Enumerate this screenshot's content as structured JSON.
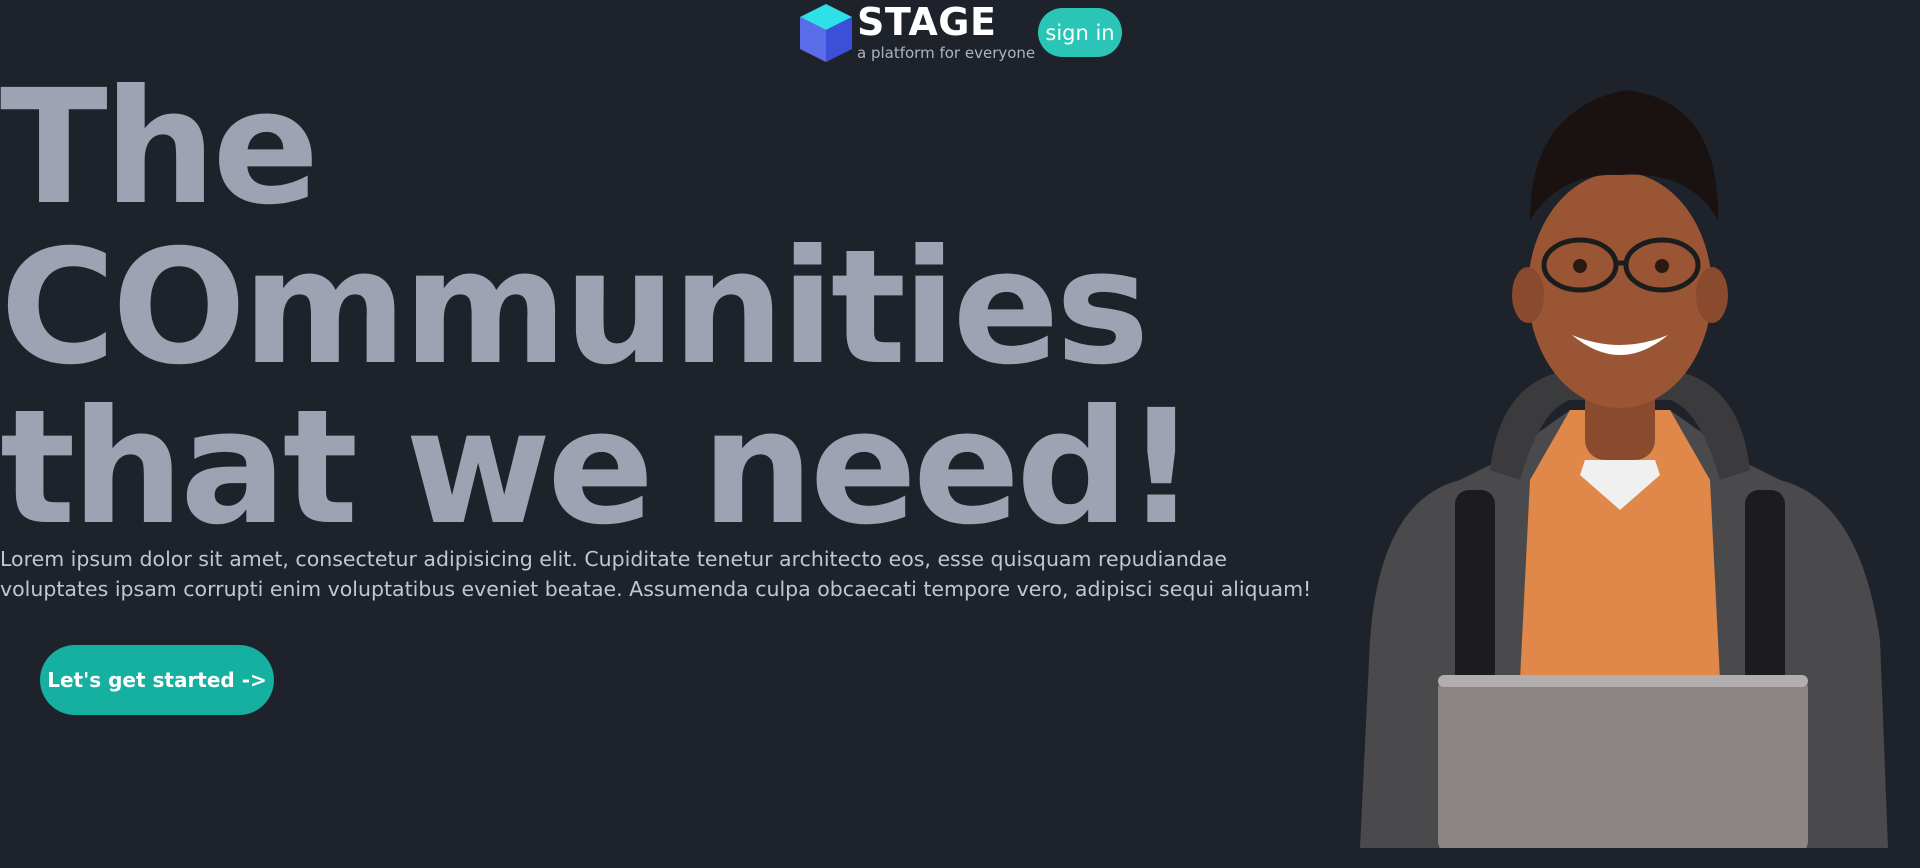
{
  "header": {
    "brand_name": "STAGE",
    "brand_tagline": "a platform for everyone",
    "signin_label": "sign in"
  },
  "hero": {
    "title_lines": [
      "The",
      "COmmunities",
      "that we need!"
    ],
    "description": "Lorem ipsum dolor sit amet, consectetur adipisicing elit. Cupiditate tenetur architecto eos, esse quisquam repudiandae voluptates ipsam corrupti enim voluptatibus eveniet beatae. Assumenda culpa obcaecati tempore vero, adipisci sequi aliquam!",
    "cta_label": "Let's get started ->"
  },
  "colors": {
    "background": "#1e222b",
    "accent": "#2ac5b6",
    "heading": "#9da3b2"
  },
  "icons": {
    "logo": "cube-logo-icon"
  }
}
